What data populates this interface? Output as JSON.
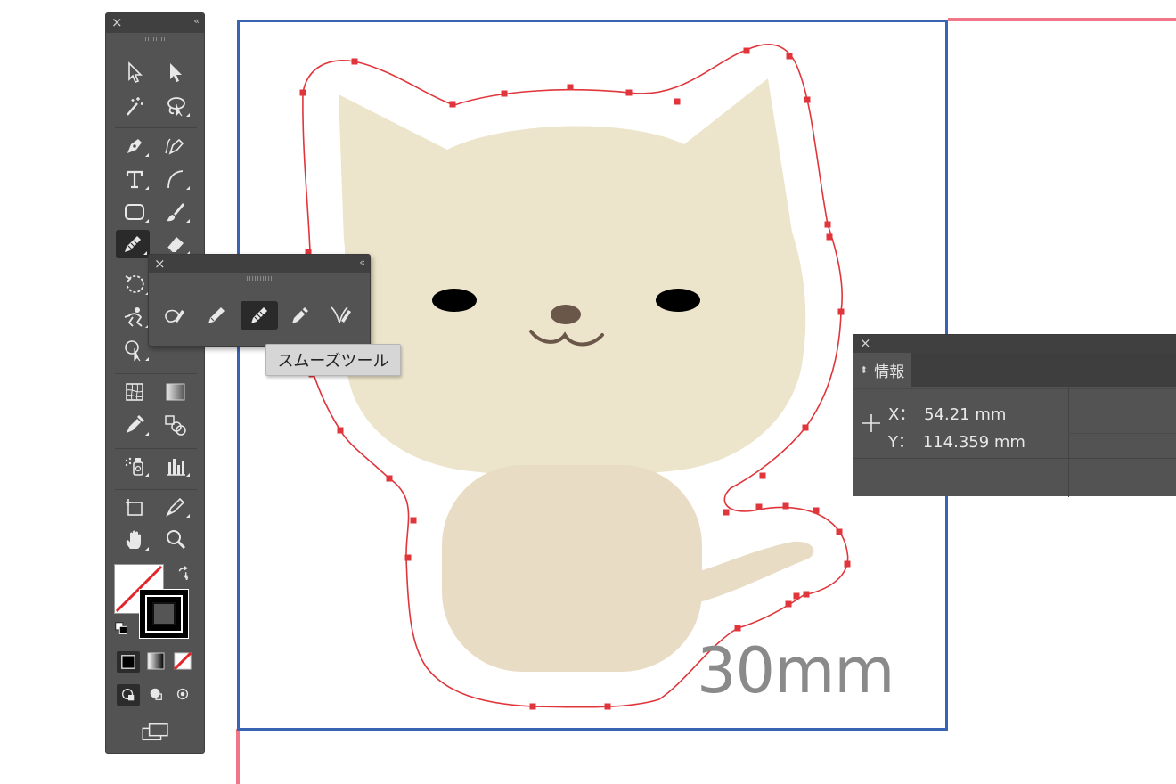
{
  "panels": {
    "tools": {
      "close_label": "×",
      "collapse_label": "‹‹"
    },
    "flyout": {
      "close_label": "×",
      "collapse_label": "‹‹"
    },
    "info": {
      "close_label": "×",
      "tab_label": "情報",
      "x_label": "X：",
      "x_value": "54.21 mm",
      "y_label": "Y：",
      "y_value": "114.359 mm"
    }
  },
  "tooltip": {
    "text": "スムーズツール"
  },
  "canvas": {
    "size_label": "30mm"
  },
  "tools_left": [
    "selection-icon",
    "magic-wand-icon",
    "pen-icon",
    "type-icon",
    "rectangle-icon",
    "pencil-tool-icon",
    "rotate-icon",
    "puppet-warp-icon",
    "shape-builder-icon",
    "mesh-icon",
    "eyedropper-icon",
    "symbol-sprayer-icon",
    "artboard-icon",
    "hand-icon"
  ],
  "tools_right": [
    "direct-selection-icon",
    "lasso-icon",
    "curvature-pen-icon",
    "arc-icon",
    "paintbrush-icon",
    "eraser-icon",
    "scale-icon",
    "free-transform-icon",
    "perspective-grid-icon",
    "gradient-icon",
    "blend-icon",
    "graph-icon",
    "slice-icon",
    "zoom-icon"
  ],
  "flyout_tools": [
    "shaper-icon",
    "pencil-icon",
    "smooth-icon",
    "path-eraser-icon",
    "join-icon"
  ],
  "colors": {
    "cat_face": "#ece5cb",
    "cat_body": "#e8dcc4",
    "cut_line": "#e0353b",
    "artboard_border": "#3a63b2",
    "guide": "#f0768a",
    "panel_bg": "#535353"
  }
}
